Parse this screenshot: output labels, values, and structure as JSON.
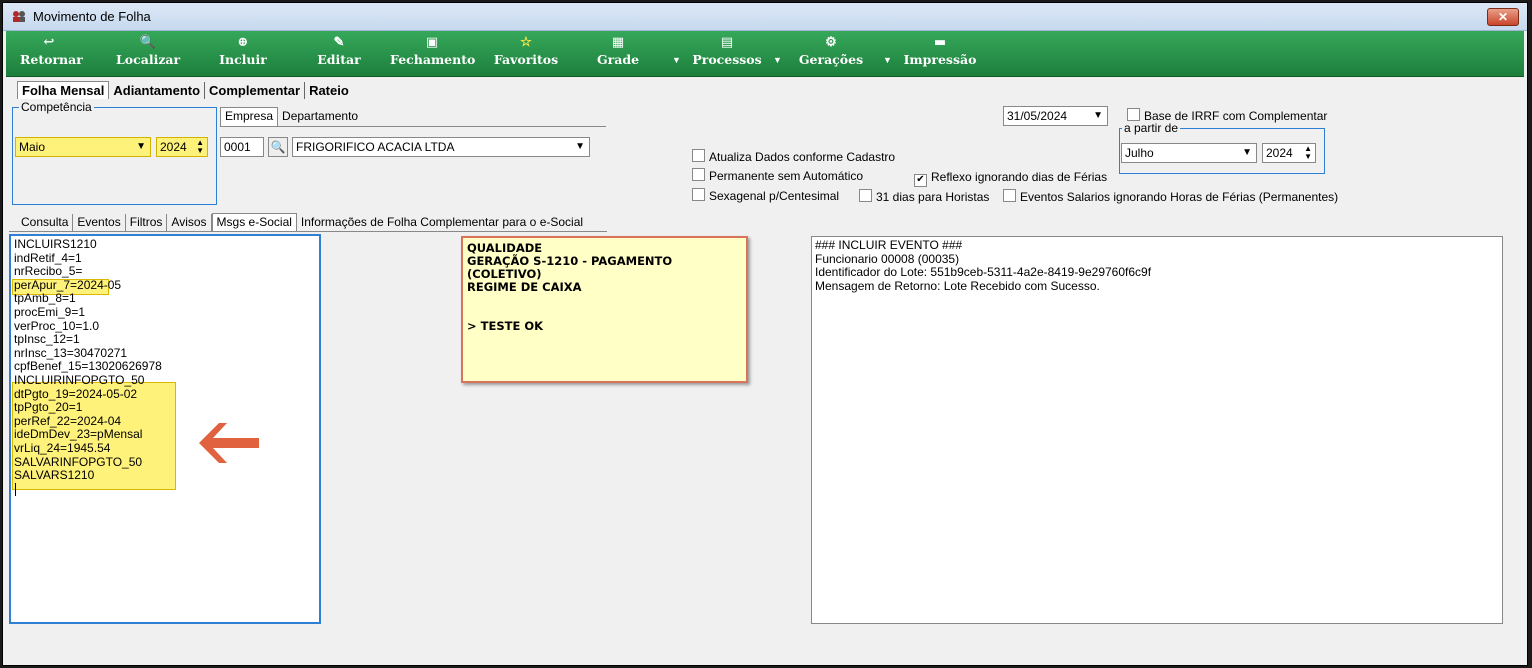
{
  "window": {
    "title": "Movimento de Folha",
    "close_label": "✕"
  },
  "toolbar": {
    "buttons": [
      {
        "label": "Retornar",
        "icon": "↩"
      },
      {
        "label": "Localizar",
        "icon": "🔍"
      },
      {
        "label": "Incluir",
        "icon": "⊕"
      },
      {
        "label": "Editar",
        "icon": "✎"
      },
      {
        "label": "Fechamento",
        "icon": "▣"
      },
      {
        "label": "Favoritos",
        "icon": "☆"
      },
      {
        "label": "Grade",
        "icon": "▦"
      },
      {
        "label": "Processos",
        "icon": "▤"
      },
      {
        "label": "Gerações",
        "icon": "⚙"
      },
      {
        "label": "Impressão",
        "icon": "▬"
      }
    ],
    "colors": {
      "bar": "#1c7f3c",
      "text": "#ffffff"
    }
  },
  "main_tabs": [
    "Folha Mensal",
    "Adiantamento",
    "Complementar",
    "Rateio"
  ],
  "competencia": {
    "title": "Competência",
    "month": "Maio",
    "year": "2024"
  },
  "empresa_tabs": [
    "Empresa",
    "Departamento"
  ],
  "empresa": {
    "code": "0001",
    "name": "FRIGORIFICO ACACIA LTDA"
  },
  "date": "31/05/2024",
  "options": {
    "base_irrf": "Base de IRRF com Complementar",
    "a_partir_de": {
      "title": "a partir de",
      "month": "Julho",
      "year": "2024"
    },
    "atualiza": "Atualiza Dados conforme Cadastro",
    "permanente": "Permanente sem Automático",
    "reflexo": "Reflexo ignorando dias de Férias",
    "sexagenal": "Sexagenal p/Centesimal",
    "dias31": "31 dias para Horistas",
    "eventos_salarios": "Eventos Salarios ignorando Horas de Férias (Permanentes)"
  },
  "sub_tabs": [
    "Consulta",
    "Eventos",
    "Filtros",
    "Avisos",
    "Msgs e-Social",
    "Informações de Folha Complementar para o e-Social"
  ],
  "left_lines": [
    "INCLUIRS1210",
    "indRetif_4=1",
    "nrRecibo_5=",
    "perApur_7=2024-05",
    "tpAmb_8=1",
    "procEmi_9=1",
    "verProc_10=1.0",
    "tpInsc_12=1",
    "nrInsc_13=30470271",
    "cpfBenef_15=13020626978",
    "INCLUIRINFOPGTO_50",
    "dtPgto_19=2024-05-02",
    "tpPgto_20=1",
    "perRef_22=2024-04",
    "ideDmDev_23=pMensal",
    "vrLiq_24=1945.54",
    "SALVARINFOPGTO_50",
    "SALVARS1210"
  ],
  "note": {
    "lines": [
      "QUALIDADE",
      "GERAÇÃO S-1210 - PAGAMENTO (COLETIVO)",
      "REGIME DE CAIXA",
      "",
      "",
      "> TESTE OK"
    ]
  },
  "right_lines": [
    "### INCLUIR EVENTO ###",
    "Funcionario 00008 (00035)",
    "Identificador do Lote: 551b9ceb-5311-4a2e-8419-9e29760f6c9f",
    "Mensagem de Retorno: Lote Recebido com Sucesso."
  ],
  "colors": {
    "highlight": "#fff27a",
    "arrow": "#e0623f",
    "focus": "#2f7fd4"
  }
}
